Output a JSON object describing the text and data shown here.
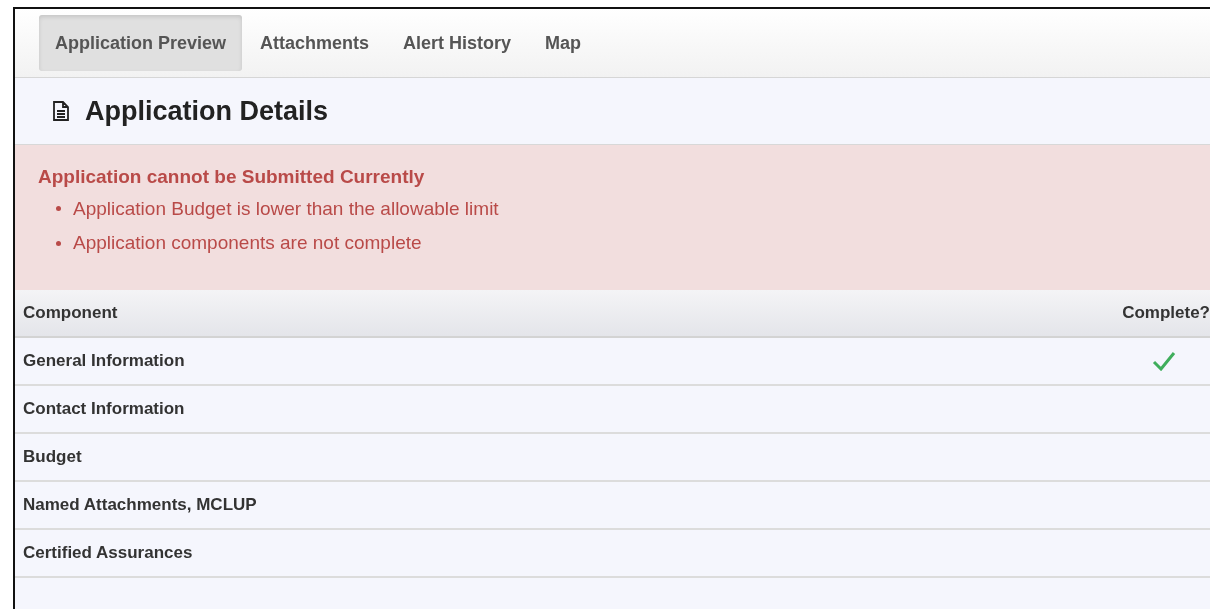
{
  "tabs": [
    {
      "label": "Application Preview",
      "selected": true
    },
    {
      "label": "Attachments",
      "selected": false
    },
    {
      "label": "Alert History",
      "selected": false
    },
    {
      "label": "Map",
      "selected": false
    }
  ],
  "header": {
    "title": "Application Details"
  },
  "alert": {
    "title": "Application cannot be Submitted Currently",
    "items": [
      "Application Budget is lower than the allowable limit",
      "Application components are not complete"
    ]
  },
  "table": {
    "columns": [
      "Component",
      "Complete?"
    ],
    "rows": [
      {
        "component": "General Information",
        "complete": true
      },
      {
        "component": "Contact Information",
        "complete": false
      },
      {
        "component": "Budget",
        "complete": false
      },
      {
        "component": "Named Attachments, MCLUP",
        "complete": false
      },
      {
        "component": "Certified Assurances",
        "complete": false
      }
    ]
  }
}
